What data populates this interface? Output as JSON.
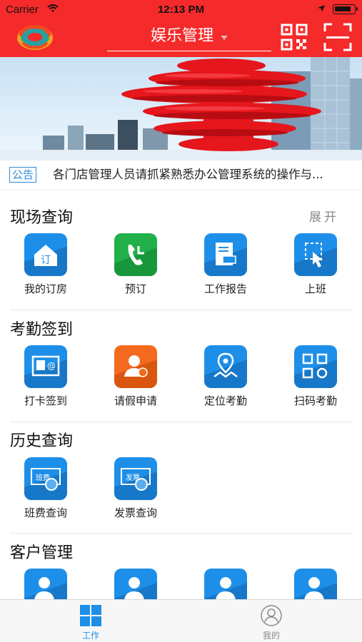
{
  "status_bar": {
    "carrier": "Carrier",
    "time": "12:13 PM"
  },
  "nav": {
    "title": "娱乐管理"
  },
  "notice": {
    "tag": "公告",
    "text": "各门店管理人员请抓紧熟悉办公管理系统的操作与..."
  },
  "sections": [
    {
      "title": "现场查询",
      "expand_label": "展开",
      "items": [
        {
          "label": "我的订房",
          "icon": "house-icon"
        },
        {
          "label": "预订",
          "icon": "phone-icon"
        },
        {
          "label": "工作报告",
          "icon": "report-icon"
        },
        {
          "label": "上班",
          "icon": "touch-icon"
        }
      ]
    },
    {
      "title": "考勤签到",
      "items": [
        {
          "label": "打卡签到",
          "icon": "id-card-icon"
        },
        {
          "label": "请假申请",
          "icon": "leave-icon"
        },
        {
          "label": "定位考勤",
          "icon": "location-icon"
        },
        {
          "label": "扫码考勤",
          "icon": "qrcode-icon"
        }
      ]
    },
    {
      "title": "历史查询",
      "items": [
        {
          "label": "班费查询",
          "icon": "ticket-icon"
        },
        {
          "label": "发票查询",
          "icon": "invoice-icon"
        }
      ]
    },
    {
      "title": "客户管理",
      "items": [
        {
          "label": "",
          "icon": "customer-settings-icon"
        },
        {
          "label": "",
          "icon": "customer-clock-icon"
        },
        {
          "label": "",
          "icon": "customer-cards-icon"
        },
        {
          "label": "",
          "icon": "customer-time-icon"
        }
      ]
    }
  ],
  "tabbar": [
    {
      "label": "工作",
      "icon": "grid-icon",
      "active": true
    },
    {
      "label": "我的",
      "icon": "user-icon",
      "active": false
    }
  ],
  "colors": {
    "primary_red": "#f52a2a",
    "accent_blue": "#1e8fe8",
    "text": "#222222",
    "muted": "#8a8a8a"
  }
}
